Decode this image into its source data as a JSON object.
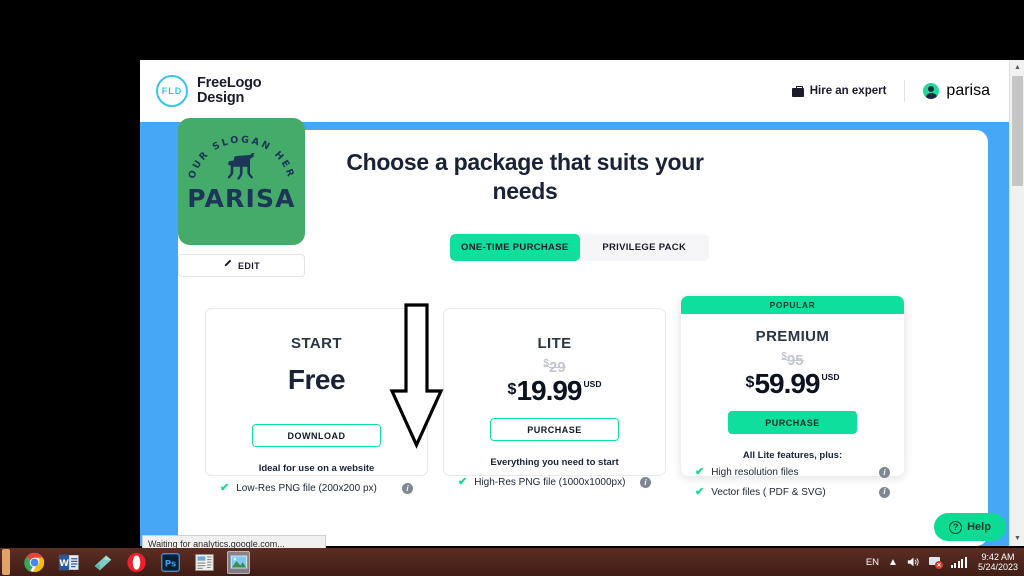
{
  "header": {
    "brand_badge": "FLD",
    "brand_line1": "FreeLogo",
    "brand_line2": "Design",
    "hire_label": "Hire an expert",
    "user_name": "parisa"
  },
  "logo_preview": {
    "slogan": "YOUR SLOGAN HERE",
    "title": "PARISA",
    "edit_label": "EDIT",
    "tile_color": "#44ab6a",
    "ink_color": "#1d3557"
  },
  "main": {
    "headline": "Choose a package that suits your needs",
    "tabs": [
      {
        "label": "ONE-TIME PURCHASE",
        "active": true
      },
      {
        "label": "PRIVILEGE PACK",
        "active": false
      }
    ]
  },
  "plans": [
    {
      "name": "START",
      "old_price": "",
      "currency": "",
      "price": "Free",
      "usd": "",
      "cta": "DOWNLOAD",
      "cta_style": "outline",
      "subtitle": "Ideal for use on a website",
      "badge": "",
      "features": [
        {
          "text": "Low-Res PNG file (200x200 px)",
          "info": "i"
        }
      ]
    },
    {
      "name": "LITE",
      "old_price": "29",
      "currency": "$",
      "price": "19.99",
      "usd": "USD",
      "cta": "PURCHASE",
      "cta_style": "outline",
      "subtitle": "Everything you need to start",
      "badge": "",
      "features": [
        {
          "text": "High-Res PNG file (1000x1000px)",
          "info": "i"
        }
      ]
    },
    {
      "name": "PREMIUM",
      "old_price": "95",
      "currency": "$",
      "price": "59.99",
      "usd": "USD",
      "cta": "PURCHASE",
      "cta_style": "solid",
      "subtitle": "All Lite features, plus:",
      "badge": "POPULAR",
      "features": [
        {
          "text": "High resolution files",
          "info": "i"
        },
        {
          "text": "Vector files ( PDF & SVG)",
          "info": "i"
        }
      ]
    }
  ],
  "help_widget": {
    "label": "Help",
    "icon": "?"
  },
  "browser_status": "Waiting for analytics.google.com...",
  "taskbar": {
    "language": "EN",
    "time": "9:42 AM",
    "date": "5/24/2023",
    "apps": [
      "chrome-icon",
      "word-icon",
      "onenote-icon",
      "opera-icon",
      "photoshop-icon",
      "publisher-icon",
      "photos-icon"
    ]
  },
  "colors": {
    "accent_green": "#0fdf9c",
    "band_blue": "#45a7f5",
    "ink": "#1a2238"
  }
}
